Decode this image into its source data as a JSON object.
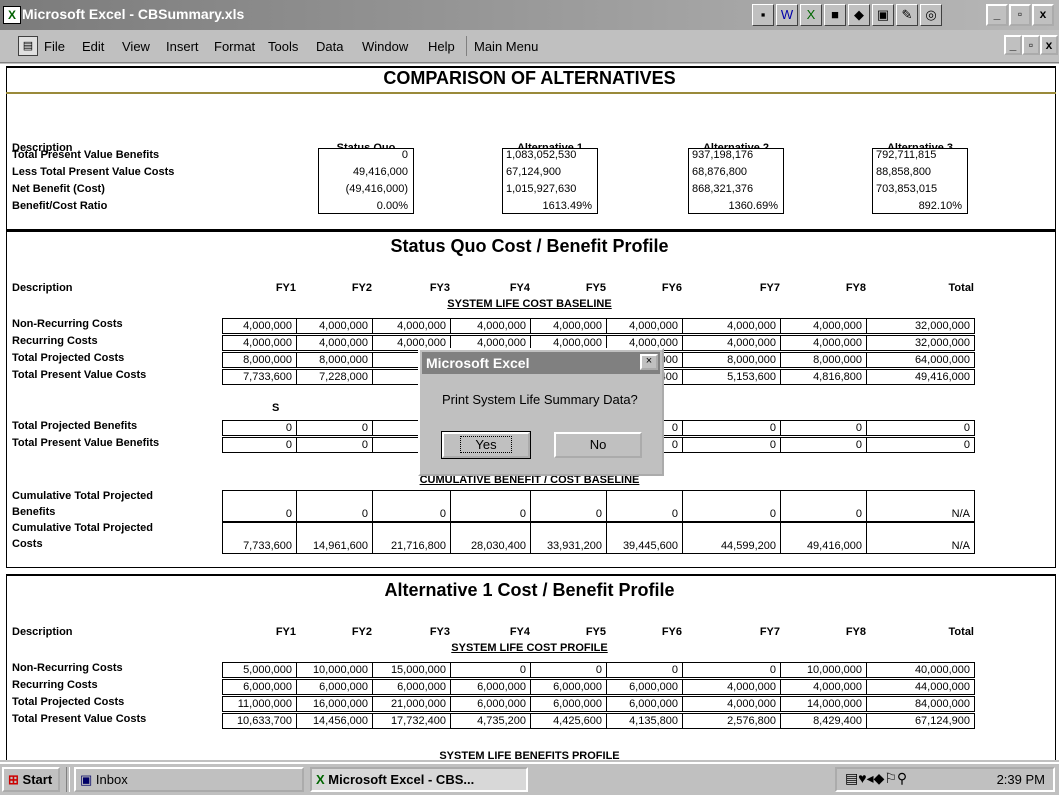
{
  "window": {
    "title": "Microsoft Excel - CBSummary.xls",
    "min": "_",
    "restore": "▫",
    "close": "x"
  },
  "menu": {
    "items": [
      "File",
      "Edit",
      "View",
      "Insert",
      "Format",
      "Tools",
      "Data",
      "Window",
      "Help",
      "Main Menu"
    ]
  },
  "summary": {
    "heading": "COMPARISON OF ALTERNATIVES",
    "desc_label": "Description",
    "columns": [
      "Status Quo",
      "Alternative 1",
      "Alternative 2",
      "Alternative 3"
    ],
    "rows": [
      {
        "label": "Total Present Value Benefits",
        "values": [
          "0",
          "1,083,052,530",
          "937,198,176",
          "792,711,815"
        ]
      },
      {
        "label": "Less Total Present Value Costs",
        "values": [
          "49,416,000",
          "67,124,900",
          "68,876,800",
          "88,858,800"
        ]
      },
      {
        "label": "Net Benefit (Cost)",
        "values": [
          "(49,416,000)",
          "1,015,927,630",
          "868,321,376",
          "703,853,015"
        ]
      },
      {
        "label": "Benefit/Cost Ratio",
        "values": [
          "0.00%",
          "1613.49%",
          "1360.69%",
          "892.10%"
        ]
      }
    ]
  },
  "sq": {
    "heading": "Status Quo Cost / Benefit Profile",
    "desc_label": "Description",
    "fy": [
      "FY1",
      "FY2",
      "FY3",
      "FY4",
      "FY5",
      "FY6",
      "FY7",
      "FY8",
      "Total"
    ],
    "cost_title": "SYSTEM LIFE COST BASELINE",
    "cost_rows": [
      {
        "label": "Non-Recurring Costs",
        "values": [
          "4,000,000",
          "4,000,000",
          "4,000,000",
          "4,000,000",
          "4,000,000",
          "4,000,000",
          "4,000,000",
          "4,000,000",
          "32,000,000"
        ]
      },
      {
        "label": "Recurring Costs",
        "values": [
          "4,000,000",
          "4,000,000",
          "4,000,000",
          "4,000,000",
          "4,000,000",
          "4,000,000",
          "4,000,000",
          "4,000,000",
          "32,000,000"
        ]
      },
      {
        "label": "Total Projected Costs",
        "values": [
          "8,000,000",
          "8,000,000",
          "",
          "",
          "000",
          "8,000,000",
          "8,000,000",
          "8,000,000",
          "64,000,000"
        ]
      },
      {
        "label": "Total Present Value Costs",
        "values": [
          "7,733,600",
          "7,228,000",
          "",
          "",
          "800",
          "5,514,400",
          "5,153,600",
          "4,816,800",
          "49,416,000"
        ]
      }
    ],
    "benefit_title_fragment": "S",
    "benefit_rows": [
      {
        "label": "Total Projected Benefits",
        "values": [
          "0",
          "0",
          "",
          "",
          "0",
          "0",
          "0",
          "0",
          "0"
        ]
      },
      {
        "label": "Total Present Value Benefits",
        "values": [
          "0",
          "0",
          "",
          "",
          "0",
          "0",
          "0",
          "0",
          "0"
        ]
      }
    ],
    "cum_title": "CUMULATIVE BENEFIT / COST BASELINE",
    "cum_rows": [
      {
        "label1": "Cumulative Total Projected",
        "label2": "Benefits",
        "values": [
          "0",
          "0",
          "0",
          "0",
          "0",
          "0",
          "0",
          "0",
          "N/A"
        ]
      },
      {
        "label1": "Cumulative Total Projected",
        "label2": "Costs",
        "values": [
          "7,733,600",
          "14,961,600",
          "21,716,800",
          "28,030,400",
          "33,931,200",
          "39,445,600",
          "44,599,200",
          "49,416,000",
          "N/A"
        ]
      }
    ]
  },
  "alt1": {
    "heading": "Alternative 1 Cost / Benefit Profile",
    "desc_label": "Description",
    "fy": [
      "FY1",
      "FY2",
      "FY3",
      "FY4",
      "FY5",
      "FY6",
      "FY7",
      "FY8",
      "Total"
    ],
    "cost_title": "SYSTEM LIFE COST PROFILE",
    "cost_rows": [
      {
        "label": "Non-Recurring Costs",
        "values": [
          "5,000,000",
          "10,000,000",
          "15,000,000",
          "0",
          "0",
          "0",
          "0",
          "10,000,000",
          "40,000,000"
        ]
      },
      {
        "label": "Recurring Costs",
        "values": [
          "6,000,000",
          "6,000,000",
          "6,000,000",
          "6,000,000",
          "6,000,000",
          "6,000,000",
          "4,000,000",
          "4,000,000",
          "44,000,000"
        ]
      },
      {
        "label": "Total Projected Costs",
        "values": [
          "11,000,000",
          "16,000,000",
          "21,000,000",
          "6,000,000",
          "6,000,000",
          "6,000,000",
          "4,000,000",
          "14,000,000",
          "84,000,000"
        ]
      },
      {
        "label": "Total Present Value Costs",
        "values": [
          "10,633,700",
          "14,456,000",
          "17,732,400",
          "4,735,200",
          "4,425,600",
          "4,135,800",
          "2,576,800",
          "8,429,400",
          "67,124,900"
        ]
      }
    ],
    "benefit_title": "SYSTEM LIFE BENEFITS PROFILE"
  },
  "dialog": {
    "title": "Microsoft Excel",
    "message": "Print System Life Summary Data?",
    "yes": "Yes",
    "no": "No",
    "close": "×"
  },
  "taskbar": {
    "start": "Start",
    "inbox": "Inbox",
    "excel": "Microsoft Excel - CBS...",
    "clock": "2:39 PM"
  }
}
